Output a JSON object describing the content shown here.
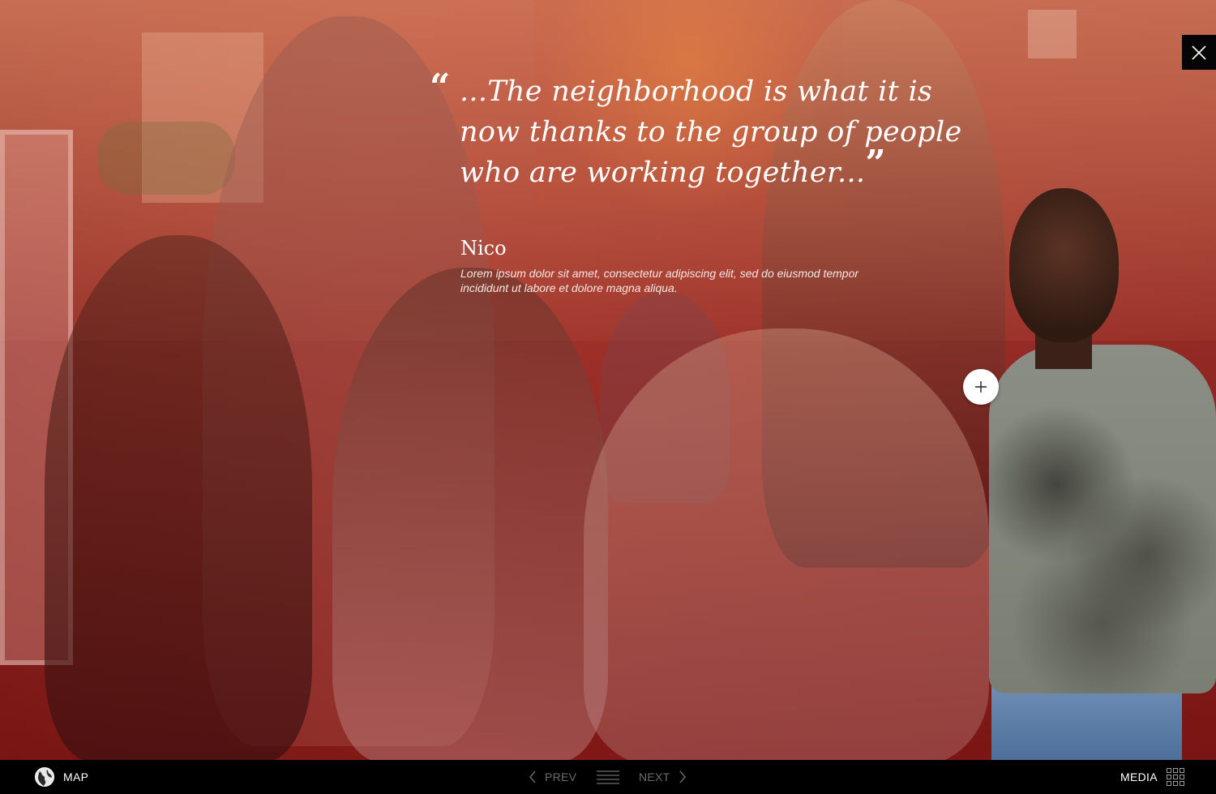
{
  "quote": {
    "text": "...The neighborhood is what it is now thanks to the group of people who are working together...",
    "open_mark": "“",
    "close_mark": "”"
  },
  "speaker": {
    "name": "Nico",
    "bio": "Lorem ipsum dolor sit amet, consectetur adipiscing elit, sed do eiusmod tempor incididunt ut labore et dolore magna aliqua."
  },
  "nav": {
    "map_label": "MAP",
    "prev_label": "PREV",
    "next_label": "NEXT",
    "media_label": "MEDIA"
  },
  "icons": {
    "close": "close-icon",
    "plus": "plus-icon",
    "globe": "globe-icon",
    "chevron_left": "chevron-left-icon",
    "chevron_right": "chevron-right-icon",
    "list": "list-icon",
    "grid": "grid-icon"
  },
  "colors": {
    "overlay_top": "#c25f46",
    "overlay_bottom": "#7a0f0f",
    "bar": "#000000",
    "disabled_nav": "#6c6c6c"
  }
}
